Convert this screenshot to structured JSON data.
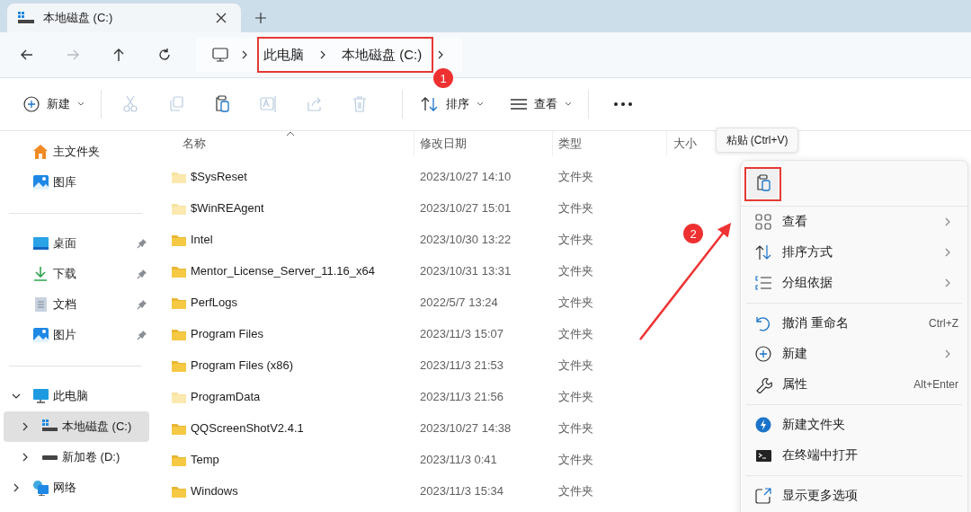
{
  "tabs": [
    {
      "label": "本地磁盘 (C:)",
      "selected": true
    }
  ],
  "nav": [
    {
      "disabled": false
    },
    {
      "disabled": true
    },
    {
      "disabled": false
    },
    {
      "disabled": false
    }
  ],
  "breadcrumb": [
    "此电脑",
    "本地磁盘 (C:)"
  ],
  "toolbar": {
    "new": "新建",
    "actions": [
      {
        "disabled": true
      },
      {
        "disabled": true
      },
      {
        "disabled": false
      },
      {
        "disabled": true
      },
      {
        "disabled": true
      },
      {
        "disabled": true
      }
    ],
    "sort": "排序",
    "view": "查看"
  },
  "sidebar": {
    "groups": [
      [
        {
          "label": "主文件夹",
          "pinned": false
        },
        {
          "label": "图库",
          "pinned": false
        }
      ],
      [
        {
          "label": "桌面",
          "pinned": true
        },
        {
          "label": "下载",
          "pinned": true
        },
        {
          "label": "文档",
          "pinned": true
        },
        {
          "label": "图片",
          "pinned": true
        }
      ],
      [
        {
          "label": "此电脑",
          "expanded": true,
          "selected": false,
          "children": [
            {
              "label": "本地磁盘 (C:)",
              "expanded": false,
              "selected": true
            },
            {
              "label": "新加卷 (D:)",
              "expanded": false,
              "selected": false
            }
          ]
        },
        {
          "label": "网络",
          "expanded": false,
          "selected": false
        }
      ]
    ]
  },
  "table": {
    "columns": [
      {
        "label": "名称",
        "sorted": true
      },
      {
        "label": "修改日期",
        "sorted": false
      },
      {
        "label": "类型",
        "sorted": false
      },
      {
        "label": "大小",
        "sorted": false
      }
    ],
    "rows": [
      {
        "name": "$SysReset",
        "date": "2023/10/27 14:10",
        "type": "文件夹",
        "hidden": true
      },
      {
        "name": "$WinREAgent",
        "date": "2023/10/27 15:01",
        "type": "文件夹",
        "hidden": true
      },
      {
        "name": "Intel",
        "date": "2023/10/30 13:22",
        "type": "文件夹",
        "hidden": false
      },
      {
        "name": "Mentor_License_Server_11.16_x64",
        "date": "2023/10/31 13:31",
        "type": "文件夹",
        "hidden": false
      },
      {
        "name": "PerfLogs",
        "date": "2022/5/7 13:24",
        "type": "文件夹",
        "hidden": false
      },
      {
        "name": "Program Files",
        "date": "2023/11/3 15:07",
        "type": "文件夹",
        "hidden": false
      },
      {
        "name": "Program Files (x86)",
        "date": "2023/11/3 21:53",
        "type": "文件夹",
        "hidden": false
      },
      {
        "name": "ProgramData",
        "date": "2023/11/3 21:56",
        "type": "文件夹",
        "hidden": true
      },
      {
        "name": "QQScreenShotV2.4.1",
        "date": "2023/10/27 14:38",
        "type": "文件夹",
        "hidden": false
      },
      {
        "name": "Temp",
        "date": "2023/11/3 0:41",
        "type": "文件夹",
        "hidden": false
      },
      {
        "name": "Windows",
        "date": "2023/11/3 15:34",
        "type": "文件夹",
        "hidden": false
      }
    ]
  },
  "tooltip": "粘贴 (Ctrl+V)",
  "context_menu": {
    "groups": [
      [
        {
          "label": "查看",
          "submenu": true
        },
        {
          "label": "排序方式",
          "submenu": true
        },
        {
          "label": "分组依据",
          "submenu": true
        }
      ],
      [
        {
          "label": "撤消 重命名",
          "shortcut": "Ctrl+Z",
          "submenu": false
        },
        {
          "label": "新建",
          "submenu": true
        },
        {
          "label": "属性",
          "shortcut": "Alt+Enter",
          "submenu": false
        }
      ],
      [
        {
          "label": "新建文件夹",
          "submenu": false
        },
        {
          "label": "在终端中打开",
          "submenu": false
        }
      ],
      [
        {
          "label": "显示更多选项",
          "submenu": false
        }
      ]
    ]
  },
  "annotations": {
    "badges": [
      "1",
      "2"
    ]
  }
}
